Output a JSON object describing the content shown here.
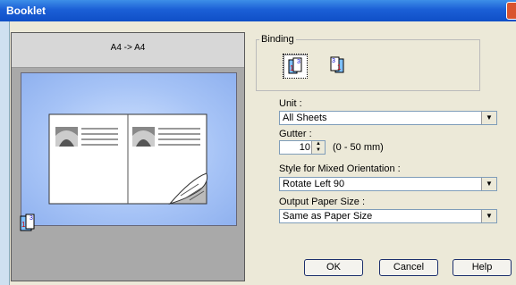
{
  "window": {
    "title": "Booklet"
  },
  "preview": {
    "label": "A4 -> A4"
  },
  "binding": {
    "legend": "Binding"
  },
  "unit": {
    "label": "Unit :",
    "value": "All Sheets"
  },
  "gutter": {
    "label": "Gutter :",
    "value": "10",
    "range": "(0 - 50 mm)"
  },
  "mixed_orientation": {
    "label": "Style for Mixed Orientation :",
    "value": "Rotate Left 90"
  },
  "output_paper_size": {
    "label": "Output Paper Size :",
    "value": "Same as Paper Size"
  },
  "buttons": {
    "ok": "OK",
    "cancel": "Cancel",
    "help": "Help"
  }
}
